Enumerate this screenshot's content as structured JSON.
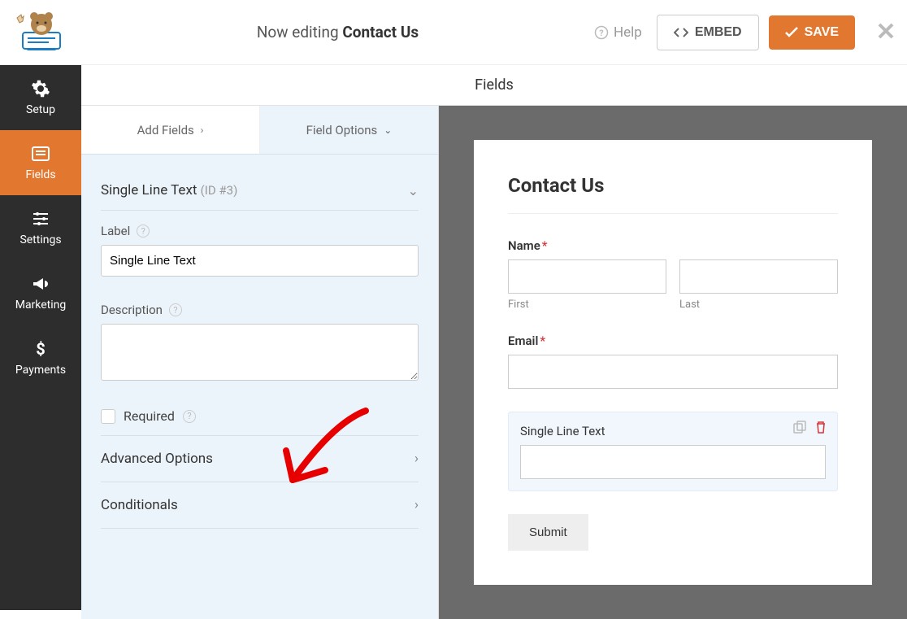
{
  "topbar": {
    "prefix": "Now editing",
    "form_name": "Contact Us",
    "help": "Help",
    "embed": "EMBED",
    "save": "SAVE"
  },
  "sidenav": [
    {
      "label": "Setup",
      "icon": "gear"
    },
    {
      "label": "Fields",
      "icon": "list"
    },
    {
      "label": "Settings",
      "icon": "sliders"
    },
    {
      "label": "Marketing",
      "icon": "bullhorn"
    },
    {
      "label": "Payments",
      "icon": "dollar"
    }
  ],
  "panel": {
    "header": "Fields",
    "tab_add": "Add Fields",
    "tab_options": "Field Options",
    "section_name": "Single Line Text",
    "section_id": "(ID #3)",
    "label_label": "Label",
    "label_value": "Single Line Text",
    "description_label": "Description",
    "required_label": "Required",
    "advanced": "Advanced Options",
    "conditionals": "Conditionals"
  },
  "preview": {
    "title": "Contact Us",
    "name_label": "Name",
    "first_sub": "First",
    "last_sub": "Last",
    "email_label": "Email",
    "single_label": "Single Line Text",
    "submit": "Submit"
  }
}
